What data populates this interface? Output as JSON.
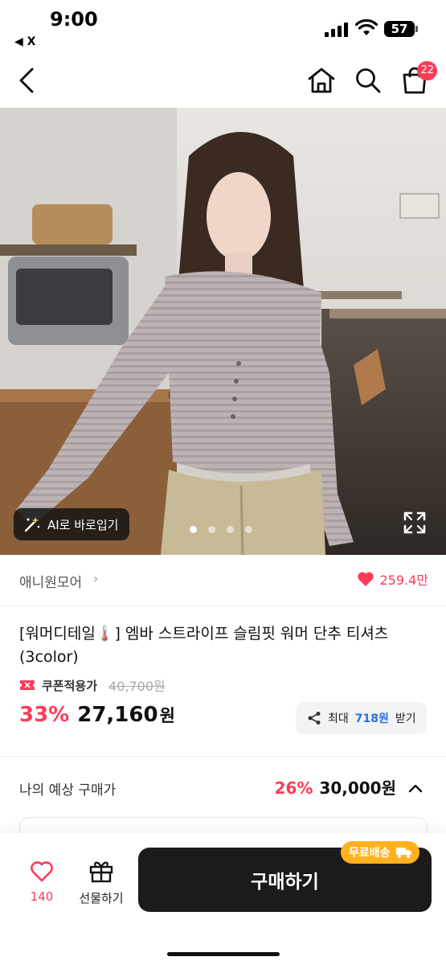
{
  "status_bar": {
    "time": "9:00",
    "back_app": "◀ X",
    "battery": "57"
  },
  "nav": {
    "cart_count": "22"
  },
  "hero": {
    "ai_button_label": "AI로 바로입기",
    "image_count": 4,
    "active_index": 0
  },
  "store": {
    "name": "애니원모어",
    "likes": "259.4만"
  },
  "product": {
    "title": "[워머디테일🌡️] 엠바 스트라이프 슬림핏 워머 단추 티셔츠 (3color)",
    "coupon_label": "쿠폰적용가",
    "original_price": "40,700원",
    "discount": "33%",
    "price": "27,160",
    "price_unit": "원",
    "reward_prefix": "최대",
    "reward_amount": "718원",
    "reward_suffix": "받기"
  },
  "estimate": {
    "label": "나의 예상 구매가",
    "discount": "26%",
    "price": "30,000원"
  },
  "bottom": {
    "like_count": "140",
    "gift_label": "선물하기",
    "buy_label": "구매하기",
    "shipping_badge": "무료배송"
  },
  "colors": {
    "accent": "#ff3b57",
    "badge": "#ffb21e",
    "reward_blue": "#2a6fe0",
    "buy_button": "#1b1b1b"
  }
}
